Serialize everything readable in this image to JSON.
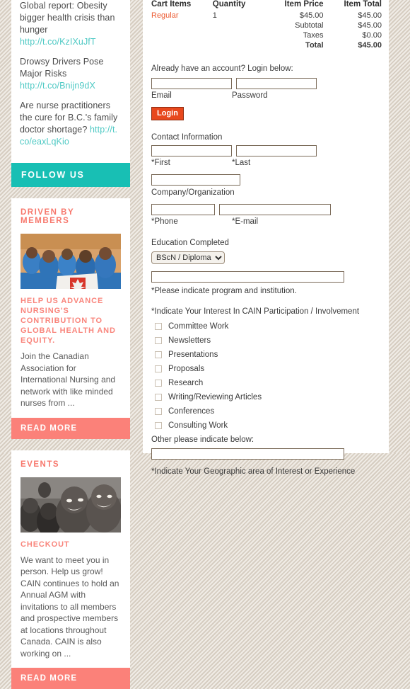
{
  "sidebar": {
    "tweets": [
      {
        "text": "Global report: Obesity bigger health crisis than hunger",
        "link": "http://t.co/KzIXuJfT"
      },
      {
        "text": "Drowsy Drivers Pose Major Risks",
        "link": "http://t.co/Bnijn9dX"
      },
      {
        "text": "Are nurse practitioners the cure for B.C.'s family doctor shortage?",
        "link": "http://t.co/eaxLqKio"
      }
    ],
    "follow_us": "FOLLOW US",
    "cards": [
      {
        "title": "DRIVEN BY MEMBERS",
        "heading": "HELP US ADVANCE NURSING'S CONTRIBUTION TO GLOBAL HEALTH AND EQUITY.",
        "body": "Join the Canadian Association for International Nursing and network with like minded nurses from ...",
        "read_more": "READ MORE"
      },
      {
        "title": "EVENTS",
        "heading": "CHECKOUT",
        "body": "We want to meet you in person. Help us grow! CAIN continues to hold an Annual AGM with invitations to all members and prospective members at locations throughout Canada. CAIN is also working on ...",
        "read_more": "READ MORE"
      }
    ]
  },
  "cart": {
    "headers": {
      "items": "Cart Items",
      "quantity": "Quantity",
      "item_price": "Item Price",
      "item_total": "Item Total"
    },
    "rows": [
      {
        "name": "Regular",
        "quantity": "1",
        "price": "$45.00",
        "total": "$45.00"
      }
    ],
    "subtotal_label": "Subtotal",
    "subtotal_value": "$45.00",
    "taxes_label": "Taxes",
    "taxes_value": "$0.00",
    "total_label": "Total",
    "total_value": "$45.00"
  },
  "login": {
    "intro": "Already have an account? Login below:",
    "email_label": "Email",
    "password_label": "Password",
    "email_value": "",
    "password_value": "",
    "button_label": "Login"
  },
  "contact": {
    "section_label": "Contact Information",
    "first_label": "*First",
    "last_label": "*Last",
    "first_value": "",
    "last_value": "",
    "company_label": "Company/Organization",
    "company_value": "",
    "phone_label": "*Phone",
    "email_label": "*E-mail",
    "phone_value": "",
    "email_value": ""
  },
  "education": {
    "section_label": "Education Completed",
    "selected": "BScN / Diploma",
    "options": [
      "BScN / Diploma"
    ],
    "program_value": "",
    "note": "*Please indicate program and institution."
  },
  "interest": {
    "title": "*Indicate Your Interest In CAIN Participation / Involvement",
    "options": [
      "Committee Work",
      "Newsletters",
      "Presentations",
      "Proposals",
      "Research",
      "Writing/Reviewing Articles",
      "Conferences",
      "Consulting Work"
    ],
    "other_label": "Other please indicate below:",
    "other_value": ""
  },
  "geographic": {
    "note": "*Indicate Your Geographic area of Interest or Experience"
  },
  "colors": {
    "teal": "#18bfb4",
    "coral": "#fb8179",
    "orange": "#e8481d",
    "link_teal": "#4ec9c4",
    "item_red": "#ec5b32"
  }
}
